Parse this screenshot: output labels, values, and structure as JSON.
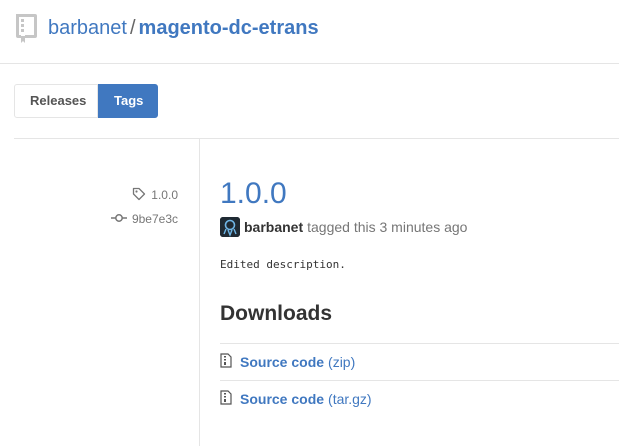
{
  "header": {
    "owner": "barbanet",
    "separator": "/",
    "repo": "magento-dc-etrans",
    "repo_icon": "repo-book-icon"
  },
  "subnav": {
    "releases_label": "Releases",
    "tags_label": "Tags",
    "selected": "Tags"
  },
  "release_meta": {
    "tag": "1.0.0",
    "tag_icon": "tag-icon",
    "commit": "9be7e3c",
    "commit_icon": "git-commit-icon"
  },
  "release": {
    "title": "1.0.0",
    "author": "barbanet",
    "action_text": "tagged this 3 minutes ago",
    "body": "Edited description."
  },
  "downloads": {
    "heading": "Downloads",
    "items": [
      {
        "label": "Source code",
        "ext": "(zip)",
        "icon": "file-zip-icon"
      },
      {
        "label": "Source code",
        "ext": "(tar.gz)",
        "icon": "file-zip-icon"
      }
    ]
  },
  "colors": {
    "link": "#4078c0",
    "selected_tab_bg": "#4078c0",
    "muted_text": "#767676",
    "border": "#e5e5e5"
  }
}
